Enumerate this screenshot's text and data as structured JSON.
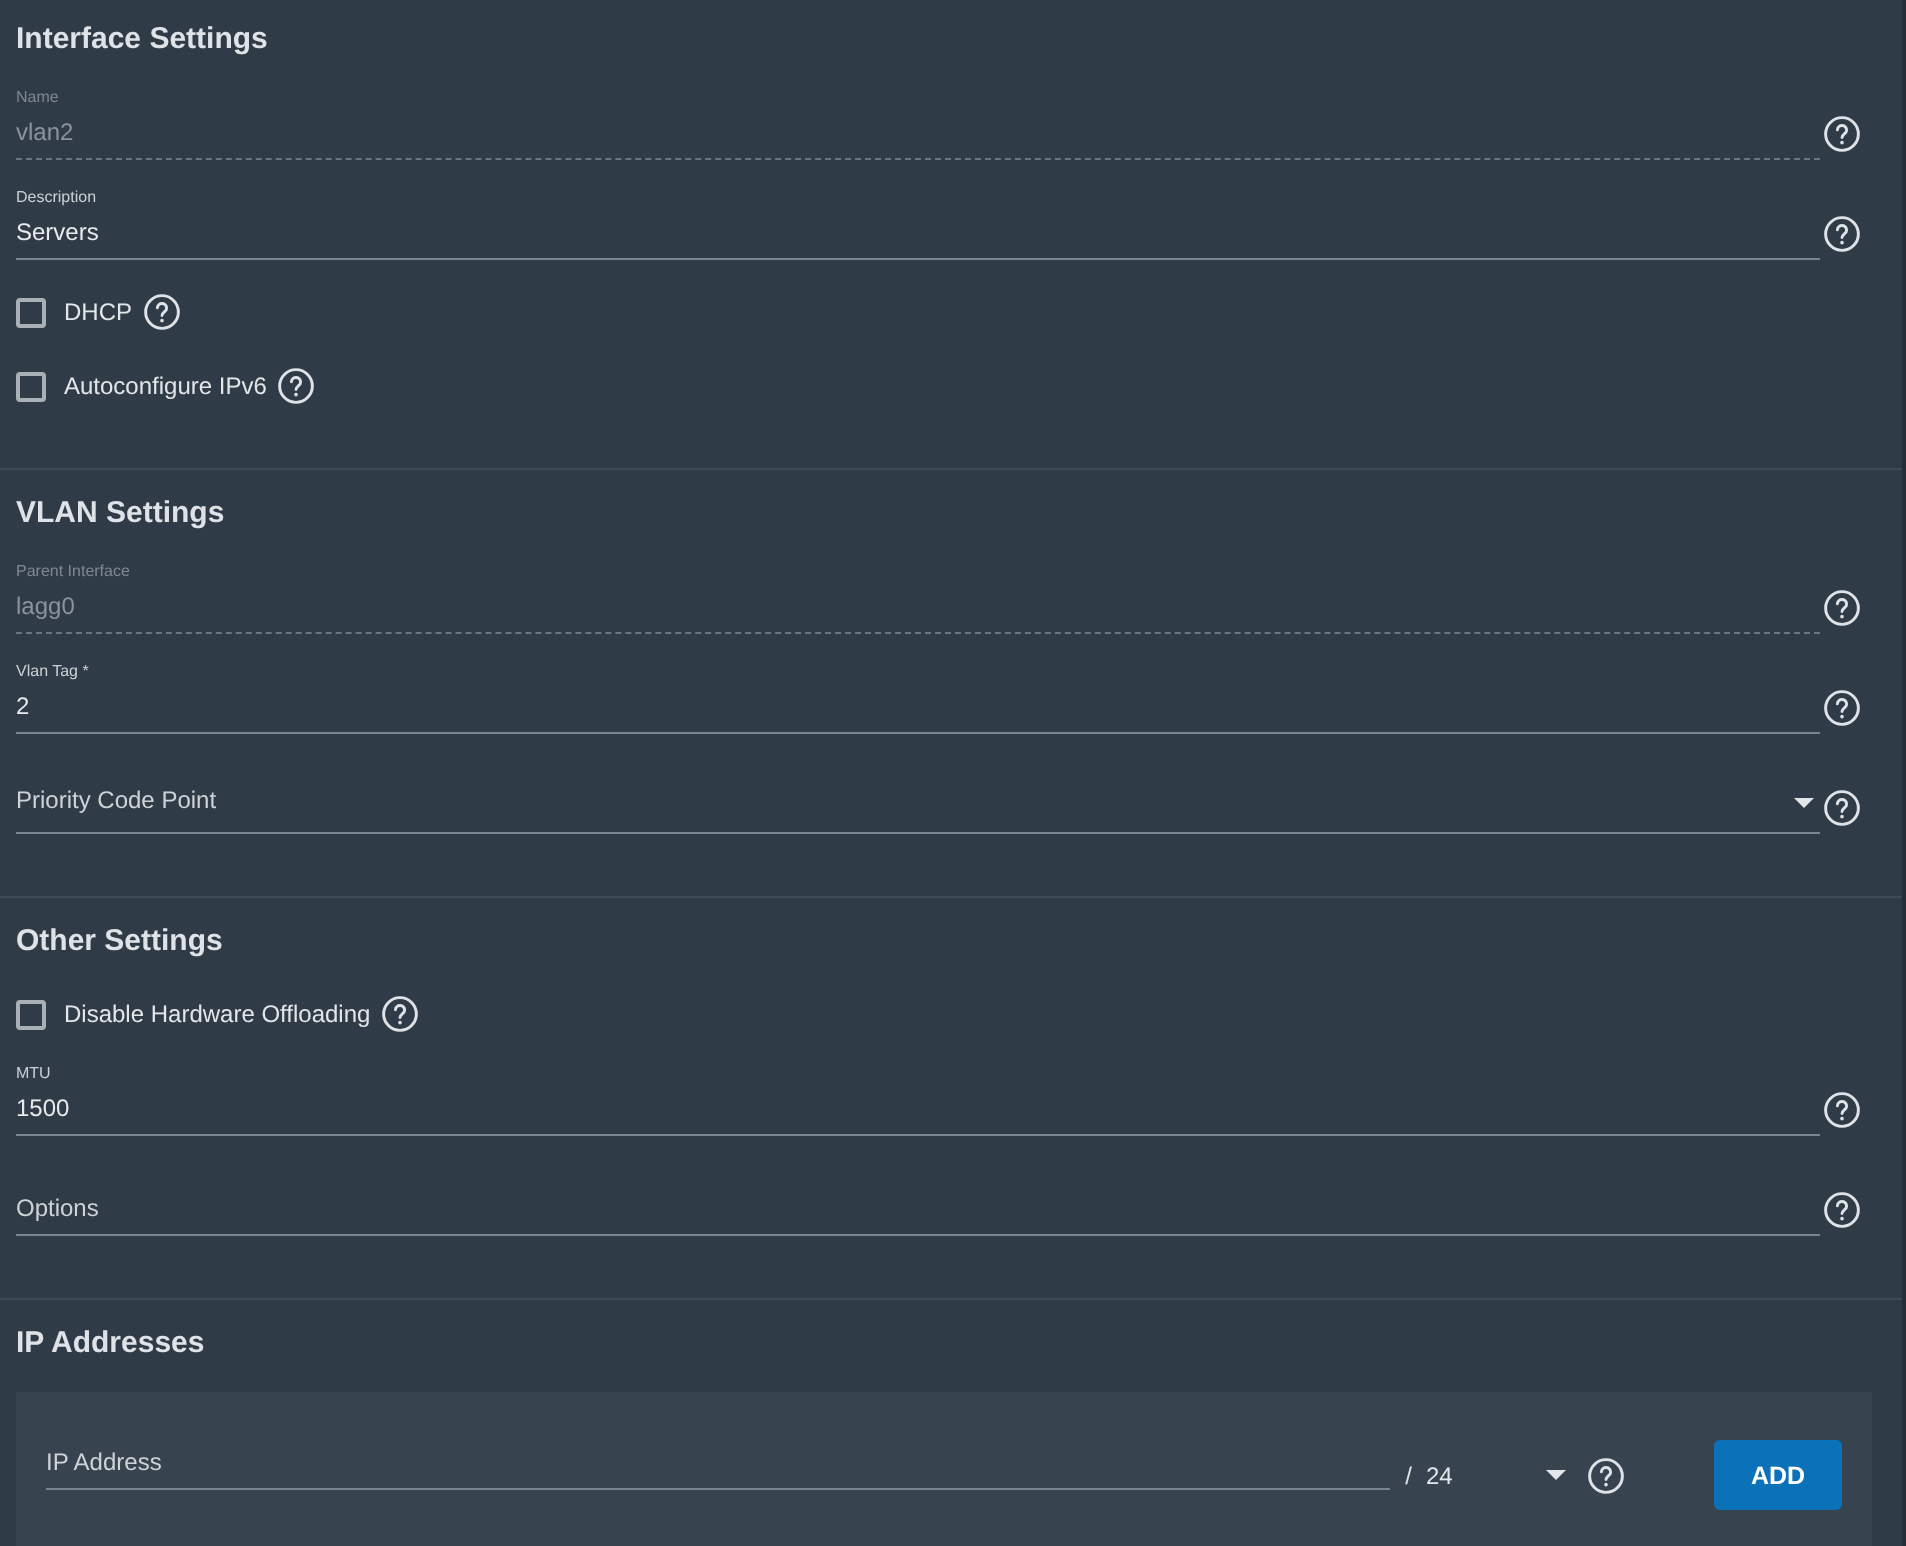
{
  "sections": [
    {
      "title": "Interface Settings",
      "items": [
        {
          "kind": "input",
          "label": "Name",
          "value": "vlan2",
          "disabled": true,
          "help": true
        },
        {
          "kind": "input",
          "label": "Description",
          "value": "Servers",
          "disabled": false,
          "help": true
        },
        {
          "kind": "checkbox",
          "label": "DHCP",
          "checked": false,
          "help": true
        },
        {
          "kind": "checkbox",
          "label": "Autoconfigure IPv6",
          "checked": false,
          "help": true
        }
      ]
    },
    {
      "title": "VLAN Settings",
      "items": [
        {
          "kind": "input",
          "label": "Parent Interface",
          "value": "lagg0",
          "disabled": true,
          "help": true
        },
        {
          "kind": "input",
          "label": "Vlan Tag *",
          "value": "2",
          "disabled": false,
          "help": true
        },
        {
          "kind": "select",
          "placeholder": "Priority Code Point",
          "help": true
        }
      ]
    },
    {
      "title": "Other Settings",
      "items": [
        {
          "kind": "checkbox",
          "label": "Disable Hardware Offloading",
          "checked": false,
          "help": true
        },
        {
          "kind": "input",
          "label": "MTU",
          "value": "1500",
          "disabled": false,
          "help": true
        },
        {
          "kind": "input",
          "placeholder": "Options",
          "disabled": false,
          "help": true
        }
      ]
    },
    {
      "title": "IP Addresses",
      "ip_rows": [
        {
          "placeholder": "IP Address",
          "separator": "/",
          "netmask": "24",
          "help": true
        }
      ],
      "button": "ADD"
    }
  ]
}
